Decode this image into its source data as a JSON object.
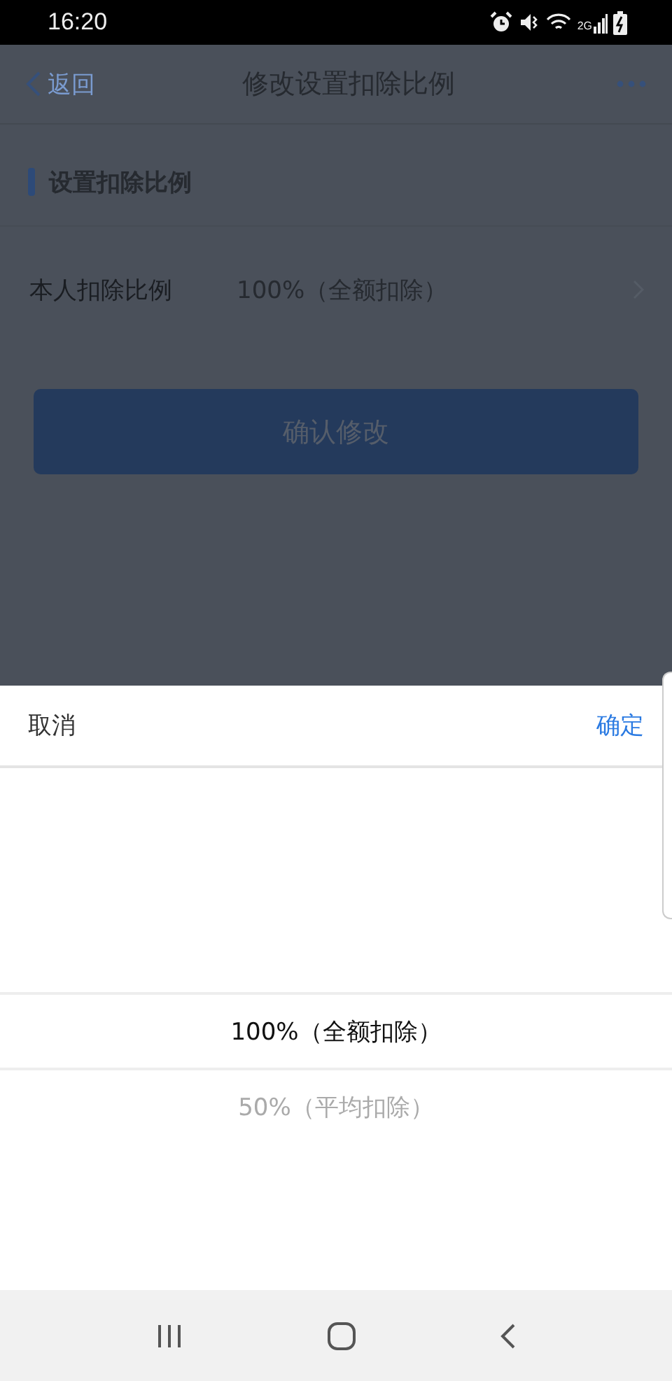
{
  "status_bar": {
    "time": "16:20",
    "network": "2G"
  },
  "nav": {
    "back": "返回",
    "title": "修改设置扣除比例"
  },
  "section": {
    "title": "设置扣除比例"
  },
  "field": {
    "label": "本人扣除比例",
    "value": "100%（全额扣除）"
  },
  "confirm_button": {
    "label": "确认修改",
    "disabled": true
  },
  "picker": {
    "cancel": "取消",
    "ok": "确定",
    "options": [
      {
        "label": "100%（全额扣除）",
        "selected": true
      },
      {
        "label": "50%（平均扣除）",
        "selected": false
      }
    ]
  }
}
